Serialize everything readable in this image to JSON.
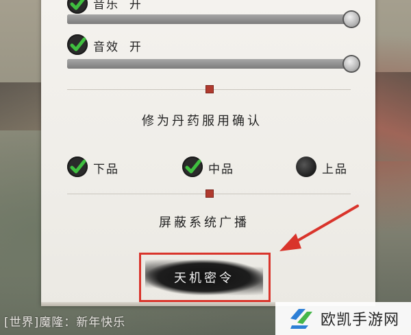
{
  "settings": {
    "music": {
      "name": "音乐",
      "state": "开",
      "checked": true,
      "volume": 1.0
    },
    "sfx": {
      "name": "音效",
      "state": "开",
      "checked": true,
      "volume": 1.0
    }
  },
  "pill_section": {
    "heading": "修为丹药服用确认",
    "options": [
      {
        "label": "下品",
        "checked": true
      },
      {
        "label": "中品",
        "checked": true
      },
      {
        "label": "上品",
        "checked": false
      }
    ]
  },
  "broadcast": {
    "heading": "屏蔽系统广播"
  },
  "secret_button": {
    "label": "天机密令"
  },
  "chat": {
    "channel": "[世界]",
    "message": "魔隆：新年快乐"
  },
  "watermark": {
    "text": "欧凯手游网"
  },
  "colors": {
    "highlight": "#d9342b",
    "seal": "#b03a2e",
    "check": "#3fbf3f"
  }
}
